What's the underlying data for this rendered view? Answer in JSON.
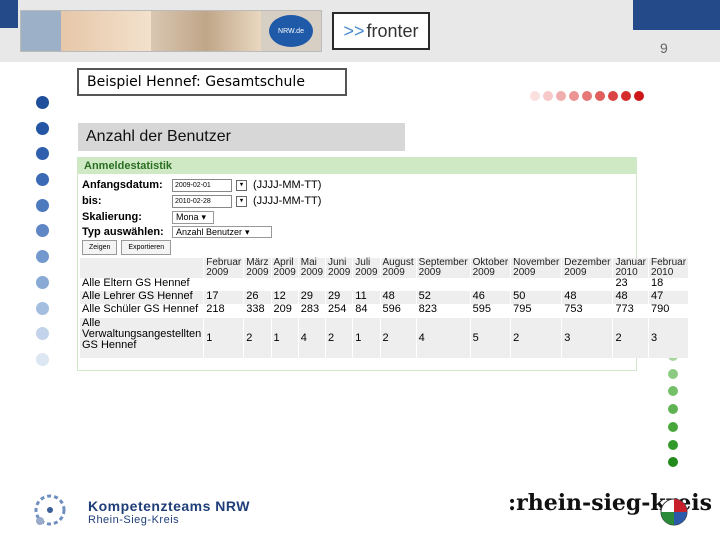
{
  "header": {
    "page_number": "9",
    "nrw_badge": "NRW.de",
    "fronter_arrows": ">>",
    "fronter_text": "fronter"
  },
  "slide": {
    "title": "Beispiel Hennef: Gesamtschule",
    "subtitle": "Anzahl der Benutzer"
  },
  "panel": {
    "heading": "Anmeldestatistik",
    "start_label": "Anfangsdatum:",
    "start_value": "2009-02-01",
    "end_label": "bis:",
    "end_value": "2010-02-28",
    "date_hint": "(JJJJ-MM-TT)",
    "scale_label": "Skalierung:",
    "scale_value": "Mona",
    "type_label": "Typ auswählen:",
    "type_value": "Anzahl Benutzer",
    "show_button": "Zeigen",
    "export_button": "Exportieren"
  },
  "table": {
    "months": [
      [
        "Februar",
        "2009"
      ],
      [
        "März",
        "2009"
      ],
      [
        "April",
        "2009"
      ],
      [
        "Mai",
        "2009"
      ],
      [
        "Juni",
        "2009"
      ],
      [
        "Juli",
        "2009"
      ],
      [
        "August",
        "2009"
      ],
      [
        "September",
        "2009"
      ],
      [
        "Oktober",
        "2009"
      ],
      [
        "November",
        "2009"
      ],
      [
        "Dezember",
        "2009"
      ],
      [
        "Januar",
        "2010"
      ],
      [
        "Februar",
        "2010"
      ]
    ],
    "rows": [
      {
        "label": "Alle Eltern GS Hennef",
        "values": [
          "",
          "",
          "",
          "",
          "",
          "",
          "",
          "",
          "",
          "",
          "",
          "23",
          "18"
        ]
      },
      {
        "label": "Alle Lehrer GS Hennef",
        "values": [
          "17",
          "26",
          "12",
          "29",
          "29",
          "11",
          "48",
          "52",
          "46",
          "50",
          "48",
          "48",
          "47"
        ]
      },
      {
        "label": "Alle Schüler GS Hennef",
        "values": [
          "218",
          "338",
          "209",
          "283",
          "254",
          "84",
          "596",
          "823",
          "595",
          "795",
          "753",
          "773",
          "790"
        ]
      },
      {
        "label_lines": [
          "Alle",
          "Verwaltungsangestellten",
          "GS Hennef"
        ],
        "values": [
          "1",
          "2",
          "1",
          "4",
          "2",
          "1",
          "2",
          "4",
          "5",
          "2",
          "3",
          "2",
          "3"
        ]
      }
    ]
  },
  "footer": {
    "kt_line1": "Kompetenzteams NRW",
    "kt_line2": "Rhein-Sieg-Kreis",
    "rsk_text": ":rhein-sieg-kreis"
  },
  "colors": {
    "left_dots": [
      "#1f4f9a",
      "#2456a3",
      "#3060ad",
      "#3d6ab5",
      "#4d79bd",
      "#5f87c5",
      "#7398cd",
      "#8aaad6",
      "#a4bedf",
      "#c2d3ea",
      "#dde6f3"
    ],
    "top_dots": [
      "#fbe0e0",
      "#f6c8c8",
      "#f1aeae",
      "#ec9494",
      "#e67878",
      "#e05e5e",
      "#da4444",
      "#d42c2c",
      "#cf1717"
    ],
    "right_dots": [
      "#e9f3e6",
      "#d3ebcf",
      "#bde1b6",
      "#a6d69c",
      "#8ecb82",
      "#76bf69",
      "#5fb352",
      "#48a73c",
      "#33992a",
      "#218a1a"
    ]
  }
}
